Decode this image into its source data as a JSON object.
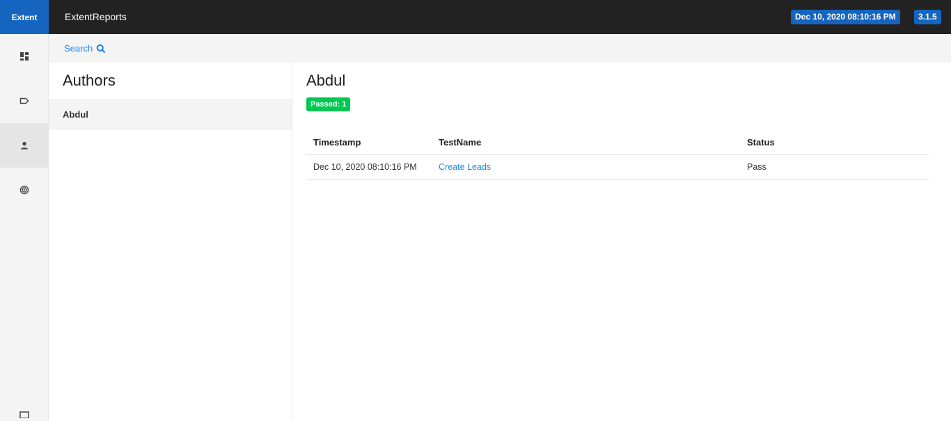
{
  "header": {
    "brand": "Extent",
    "title": "ExtentReports",
    "date_badge": "Dec 10, 2020 08:10:16 PM",
    "version_badge": "3.1.5"
  },
  "nav": {
    "items": [
      {
        "icon": "dashboard-icon"
      },
      {
        "icon": "tag-icon"
      },
      {
        "icon": "person-icon",
        "active": true
      },
      {
        "icon": "exception-icon"
      },
      {
        "icon": "monitor-icon"
      }
    ]
  },
  "search": {
    "label": "Search"
  },
  "authors": {
    "title": "Authors",
    "items": [
      "Abdul"
    ]
  },
  "detail": {
    "title": "Abdul",
    "passed_badge": "Passed: 1",
    "columns": [
      "Timestamp",
      "TestName",
      "Status"
    ],
    "rows": [
      {
        "timestamp": "Dec 10, 2020 08:10:16 PM",
        "test_name": "Create Leads",
        "status": "Pass"
      }
    ]
  },
  "colors": {
    "accent": "#1565c0",
    "topbar": "#222222",
    "pass": "#00c853",
    "link": "#1e88e5"
  }
}
